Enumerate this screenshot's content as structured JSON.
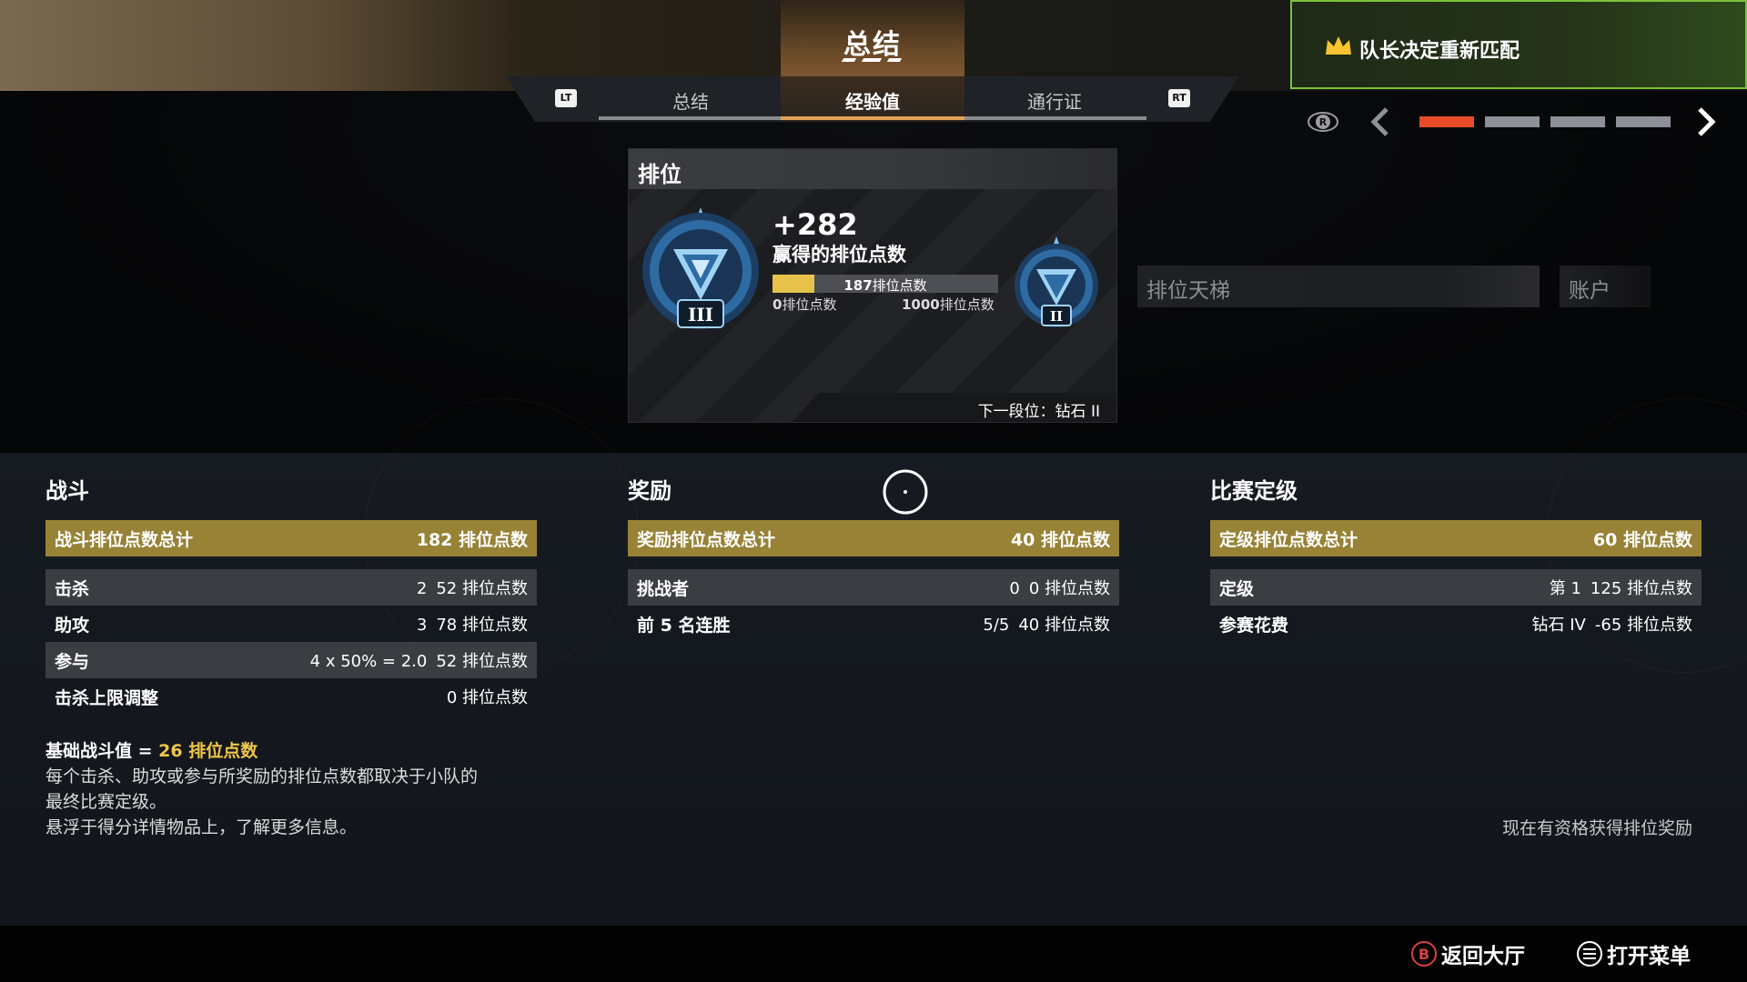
{
  "header": {
    "title": "总结",
    "tabs": [
      {
        "label": "总结",
        "active": false
      },
      {
        "label": "经验值",
        "active": true
      },
      {
        "label": "通行证",
        "active": false
      }
    ],
    "bumper_left": "LT",
    "bumper_right": "RT"
  },
  "notification": {
    "text": "队长决定重新匹配"
  },
  "pager": {
    "total": 4,
    "active_index": 0,
    "eye_key": "R"
  },
  "rank_card": {
    "heading": "排位",
    "rp_gain": "+282",
    "rp_gain_label": "赢得的排位点数",
    "progress": {
      "current_value": "187",
      "unit": "排位点数",
      "min_value": "0",
      "max_value": "1000",
      "fraction": 0.187
    },
    "current_tier_numeral": "III",
    "next_tier_numeral": "II",
    "next_rank_text": "下一段位：钻石 II"
  },
  "side_tabs": {
    "ladder": "排位天梯",
    "account": "账户"
  },
  "columns": {
    "combat": {
      "title": "战斗",
      "total_label": "战斗排位点数总计",
      "total_value": "182 排位点数",
      "rows": [
        {
          "label": "击杀",
          "count": "2",
          "value": "52 排位点数"
        },
        {
          "label": "助攻",
          "count": "3",
          "value": "78 排位点数"
        },
        {
          "label": "参与",
          "count": "4 x 50% = 2.0",
          "value": "52 排位点数"
        },
        {
          "label": "击杀上限调整",
          "count": "",
          "value": "0 排位点数"
        }
      ]
    },
    "bonus": {
      "title": "奖励",
      "total_label": "奖励排位点数总计",
      "total_value": "40 排位点数",
      "rows": [
        {
          "label": "挑战者",
          "count": "0",
          "value": "0 排位点数"
        },
        {
          "label": "前 5 名连胜",
          "count": "5/5",
          "value": "40 排位点数"
        }
      ]
    },
    "placement": {
      "title": "比赛定级",
      "total_label": "定级排位点数总计",
      "total_value": "60 排位点数",
      "rows": [
        {
          "label": "定级",
          "count": "第 1",
          "value": "125 排位点数"
        },
        {
          "label": "参赛花费",
          "count": "钻石 IV",
          "value": "-65 排位点数"
        }
      ]
    }
  },
  "note": {
    "base_label": "基础战斗值 = ",
    "base_value": "26 排位点数",
    "line2": "每个击杀、助攻或参与所奖励的排位点数都取决于小队的",
    "line3": "最终比赛定级。",
    "line4": "悬浮于得分详情物品上，了解更多信息。"
  },
  "eligible_text": "现在有资格获得排位奖励",
  "footer": {
    "back_key": "B",
    "back_label": "返回大厅",
    "menu_label": "打开菜单"
  },
  "colors": {
    "accent_gold": "#978236",
    "highlight_yellow": "#f0c64a",
    "pager_active": "#e84b2a",
    "notif_border": "#7bc23a",
    "tab_active_underline": "#e2a25a"
  }
}
